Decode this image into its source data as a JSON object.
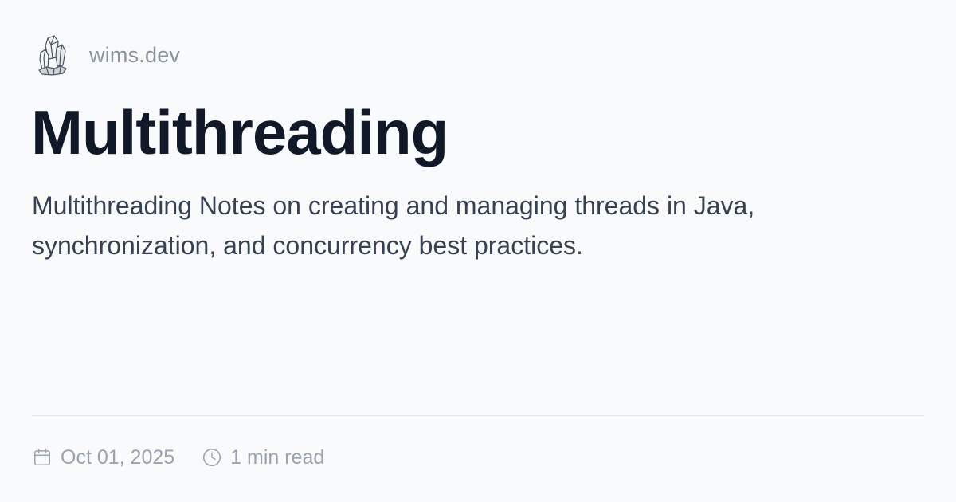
{
  "site": {
    "logo_icon": "crystal-icon",
    "name": "wims.dev"
  },
  "post": {
    "title": "Multithreading",
    "description": "Multithreading Notes on creating and managing threads in Java, synchronization, and concurrency best practices.",
    "date": "Oct 01, 2025",
    "date_icon": "calendar-icon",
    "read_time": "1 min read",
    "read_time_icon": "clock-icon"
  },
  "colors": {
    "background": "#f8fafc",
    "title": "#111827",
    "body_text": "#374151",
    "muted_text": "#9ca3af",
    "divider": "#e5e7eb"
  }
}
